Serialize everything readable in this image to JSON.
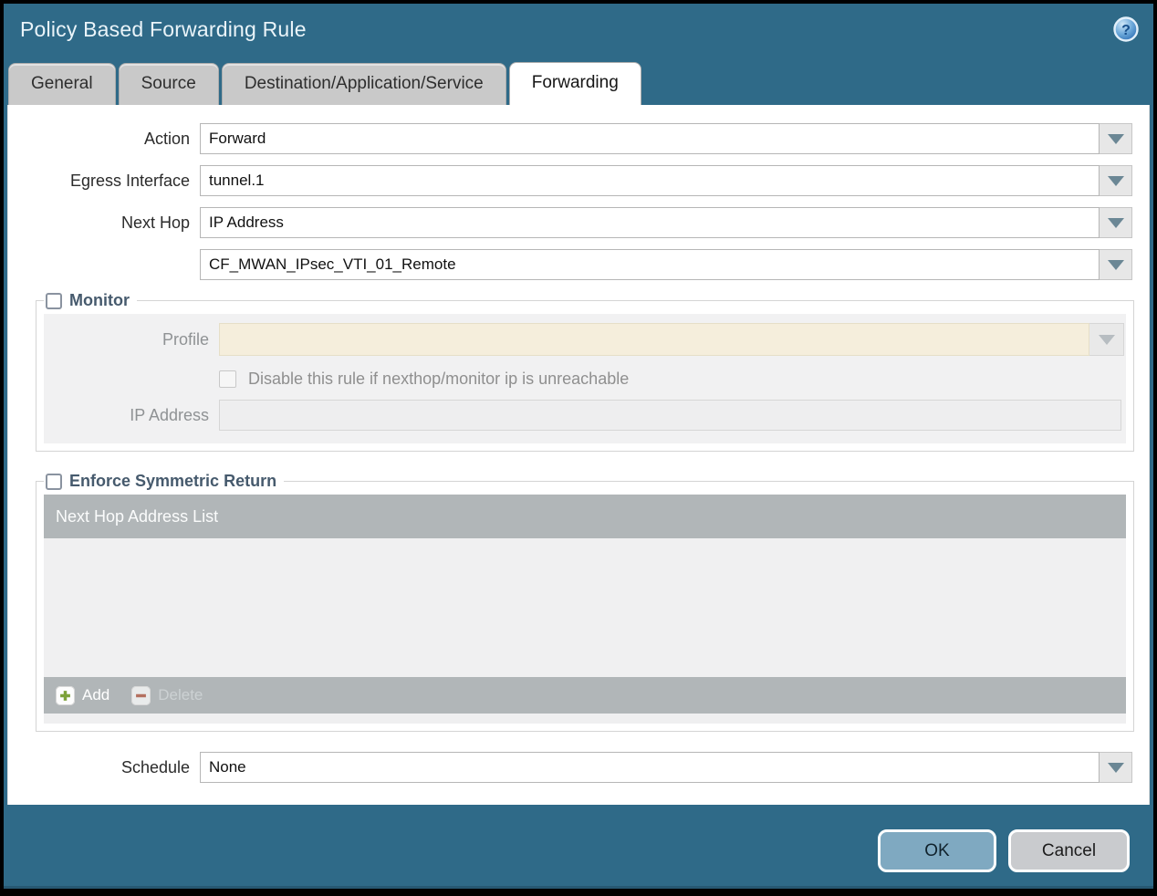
{
  "dialog": {
    "title": "Policy Based Forwarding Rule",
    "help_glyph": "?"
  },
  "tabs": [
    {
      "label": "General",
      "active": false
    },
    {
      "label": "Source",
      "active": false
    },
    {
      "label": "Destination/Application/Service",
      "active": false
    },
    {
      "label": "Forwarding",
      "active": true
    }
  ],
  "form": {
    "action": {
      "label": "Action",
      "value": "Forward"
    },
    "egress_interface": {
      "label": "Egress Interface",
      "value": "tunnel.1"
    },
    "next_hop": {
      "label": "Next Hop",
      "value": "IP Address"
    },
    "next_hop_address": {
      "value": "CF_MWAN_IPsec_VTI_01_Remote"
    },
    "schedule": {
      "label": "Schedule",
      "value": "None"
    }
  },
  "monitor": {
    "legend": "Monitor",
    "checked": false,
    "profile": {
      "label": "Profile",
      "value": ""
    },
    "disable_rule": {
      "label": "Disable this rule if nexthop/monitor ip is unreachable",
      "checked": false
    },
    "ip_address": {
      "label": "IP Address",
      "value": ""
    }
  },
  "symmetric_return": {
    "legend": "Enforce Symmetric Return",
    "checked": false,
    "table": {
      "header": "Next Hop Address List",
      "rows": [],
      "add_label": "Add",
      "delete_label": "Delete"
    }
  },
  "footer": {
    "ok_label": "OK",
    "cancel_label": "Cancel"
  },
  "icons": {
    "help": "question-mark-circle",
    "dropdown": "chevron-down-triangle",
    "add": "green-plus",
    "delete": "red-minus"
  },
  "colors": {
    "frame_teal": "#2F6A88",
    "tab_inactive": "#C9C9C9",
    "disabled_beige": "#F5EEDC",
    "table_gray": "#B1B6B8",
    "ok_button_blue": "#7FA9C1",
    "cancel_button_gray": "#C9CBCE",
    "legend_text": "#465A6D"
  }
}
